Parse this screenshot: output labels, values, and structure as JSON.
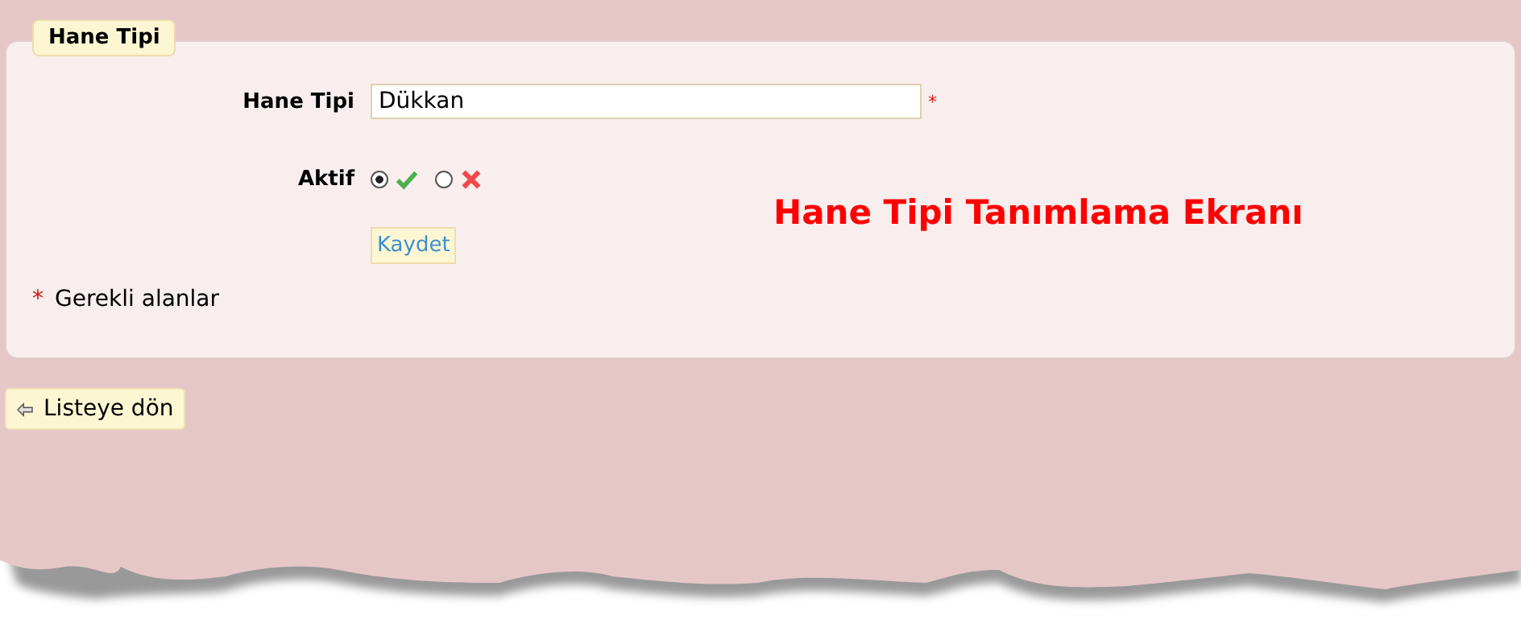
{
  "panel": {
    "legend": "Hane Tipi"
  },
  "fields": [
    {
      "kind": "text",
      "label": "Hane Tipi",
      "value": "Dükkan",
      "required_mark": "*"
    },
    {
      "kind": "radio",
      "label": "Aktif",
      "options": [
        {
          "kind": "yes",
          "selected": true
        },
        {
          "kind": "no",
          "selected": false
        }
      ]
    }
  ],
  "save_button": "Kaydet",
  "required_note": {
    "mark": "*",
    "text": "Gerekli alanlar"
  },
  "annotation": "Hane Tipi Tanımlama Ekranı",
  "back_button": "Listeye dön"
}
